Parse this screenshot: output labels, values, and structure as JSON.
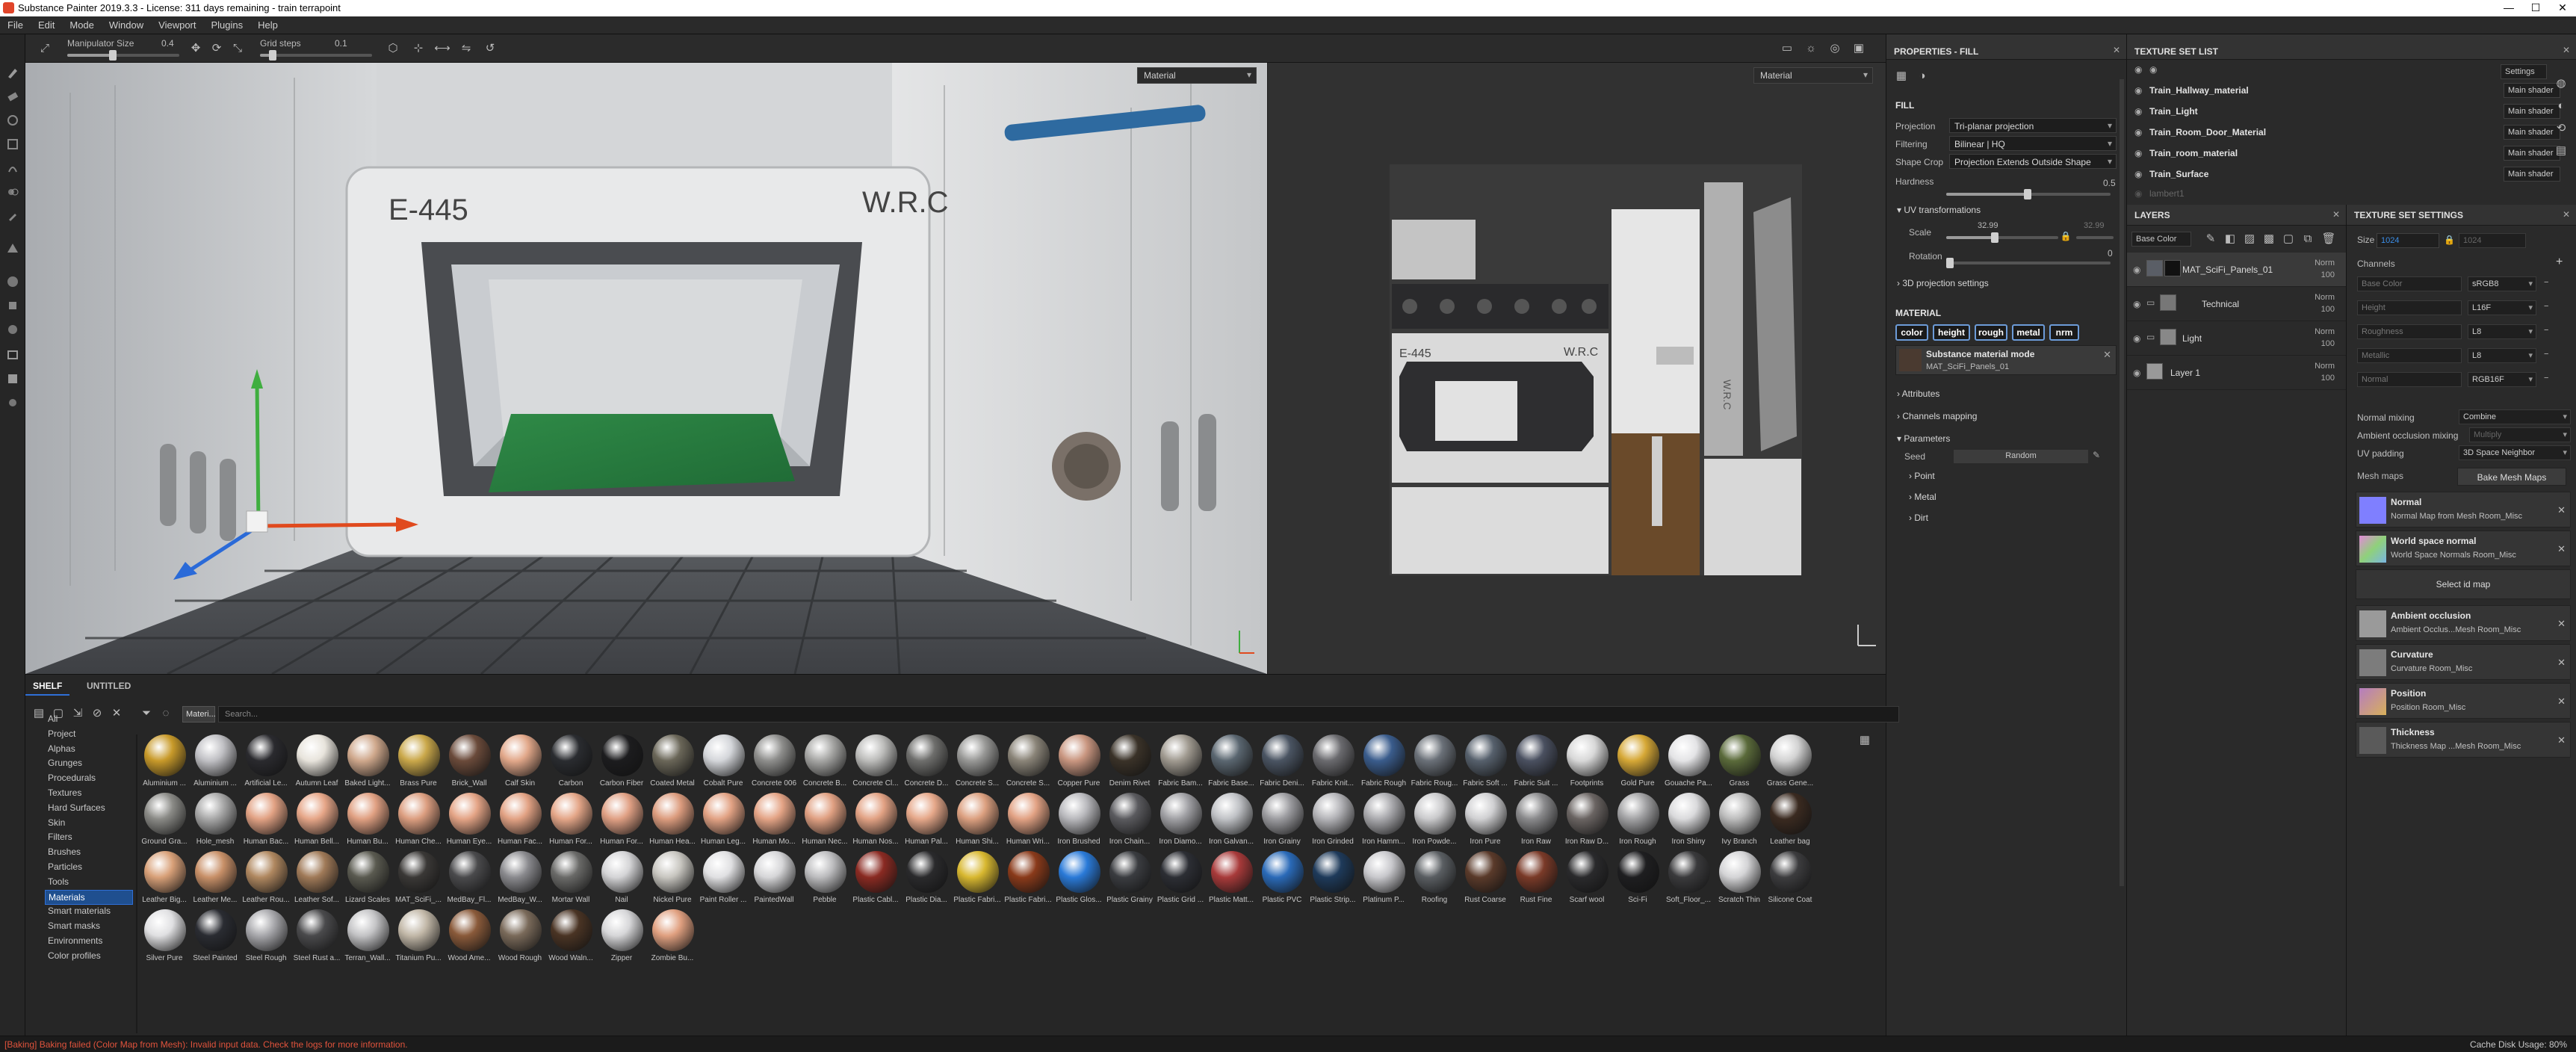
{
  "window": {
    "title": "Substance Painter 2019.3.3 - License: 311 days remaining - train terrapoint",
    "min": "—",
    "max": "☐",
    "close": "✕"
  },
  "menu": [
    "File",
    "Edit",
    "Mode",
    "Window",
    "Viewport",
    "Plugins",
    "Help"
  ],
  "toolbar": {
    "manip_label": "Manipulator Size",
    "manip_value": "0.4",
    "grid_label": "Grid steps",
    "grid_value": "0.1"
  },
  "viewport3d": {
    "mode_select": "Material",
    "texts": {
      "left_sign": "E-445",
      "right_sign": "W.R.C"
    }
  },
  "viewport2d": {
    "mode_select": "Material",
    "texts": {
      "sign_left": "E-445",
      "sign_right": "W.R.C",
      "side": "W.R.C"
    }
  },
  "properties": {
    "title": "PROPERTIES - FILL",
    "fill_header": "FILL",
    "rows": [
      {
        "label": "Projection",
        "value": "Tri-planar projection"
      },
      {
        "label": "Filtering",
        "value": "Bilinear | HQ"
      },
      {
        "label": "Shape Crop",
        "value": "Projection Extends Outside Shape"
      }
    ],
    "hardness_label": "Hardness",
    "hardness_value": "0.5",
    "uv_header": "UV transformations",
    "scale_label": "Scale",
    "scale_a": "32.99",
    "scale_b": "32.99",
    "rotation_label": "Rotation",
    "rotation_value": "0",
    "proj3d": "3D projection settings",
    "material_header": "MATERIAL",
    "chips": [
      "color",
      "height",
      "rough",
      "metal",
      "nrm"
    ],
    "sbs_mode": "Substance material mode",
    "sbs_name": "MAT_SciFi_Panels_01",
    "attributes": "Attributes",
    "channels_mapping": "Channels mapping",
    "parameters": "Parameters",
    "seed_label": "Seed",
    "seed_value": "Random",
    "groups": [
      "Point",
      "Metal",
      "Dirt"
    ]
  },
  "texture_set_list": {
    "title": "TEXTURE SET LIST",
    "settings": "Settings",
    "items": [
      {
        "name": "Train_Hallway_material",
        "shader": "Main shader"
      },
      {
        "name": "Train_Light",
        "shader": "Main shader"
      },
      {
        "name": "Train_Room_Door_Material",
        "shader": "Main shader"
      },
      {
        "name": "Train_room_material",
        "shader": "Main shader"
      },
      {
        "name": "Train_Surface",
        "shader": "Main shader"
      }
    ],
    "disabled_item": "lambert1"
  },
  "layers": {
    "title": "LAYERS",
    "channel": "Base Color",
    "items": [
      {
        "name": "MAT_SciFi_Panels_01",
        "blend": "Norm",
        "opacity": "100"
      },
      {
        "name": "Technical",
        "blend": "Norm",
        "opacity": "100"
      },
      {
        "name": "Light",
        "blend": "Norm",
        "opacity": "100"
      },
      {
        "name": "Layer 1",
        "blend": "Norm",
        "opacity": "100"
      }
    ]
  },
  "texture_set_settings": {
    "title": "TEXTURE SET SETTINGS",
    "size_label": "Size",
    "size_value": "1024",
    "size_linked": "1024",
    "channels_label": "Channels",
    "channels": [
      {
        "name": "Base Color",
        "format": "sRGB8"
      },
      {
        "name": "Height",
        "format": "L16F"
      },
      {
        "name": "Roughness",
        "format": "L8"
      },
      {
        "name": "Metallic",
        "format": "L8"
      },
      {
        "name": "Normal",
        "format": "RGB16F"
      }
    ],
    "normal_mixing_label": "Normal mixing",
    "normal_mixing_value": "Combine",
    "ao_mixing_label": "Ambient occlusion mixing",
    "ao_mixing_value": "Multiply",
    "uv_padding_label": "UV padding",
    "uv_padding_value": "3D Space Neighbor",
    "mesh_maps_label": "Mesh maps",
    "bake_button": "Bake Mesh Maps",
    "select_id": "Select id map",
    "maps": [
      {
        "title": "Normal",
        "sub": "Normal Map from Mesh Room_Misc",
        "color": "#7f7fff"
      },
      {
        "title": "World space normal",
        "sub": "World Space Normals Room_Misc",
        "color": "#8fd17a"
      },
      {
        "title": "Ambient occlusion",
        "sub": "Ambient Occlus...Mesh Room_Misc",
        "color": "#9a9a9a"
      },
      {
        "title": "Curvature",
        "sub": "Curvature Room_Misc",
        "color": "#7c7c7c"
      },
      {
        "title": "Position",
        "sub": "Position Room_Misc",
        "color": "#b57cc0"
      },
      {
        "title": "Thickness",
        "sub": "Thickness Map ...Mesh Room_Misc",
        "color": "#5a5a5a"
      }
    ]
  },
  "shelf": {
    "tab_shelf": "SHELF",
    "tab_untitled": "UNTITLED",
    "filter_chip": "Materi...",
    "search_placeholder": "Search...",
    "categories": [
      "All",
      "Project",
      "Alphas",
      "Grunges",
      "Procedurals",
      "Textures",
      "Hard Surfaces",
      "Skin",
      "Filters",
      "Brushes",
      "Particles",
      "Tools",
      "Materials",
      "Smart materials",
      "Smart masks",
      "Environments",
      "Color profiles"
    ],
    "selected_category": "Materials",
    "materials": [
      {
        "name": "Aluminium ...",
        "color": "#c89a2a"
      },
      {
        "name": "Aluminium ...",
        "color": "#c0c0c4"
      },
      {
        "name": "Artificial Le...",
        "color": "#2a2a2e"
      },
      {
        "name": "Autumn Leaf",
        "color": "#e8e4dc"
      },
      {
        "name": "Baked Light...",
        "color": "#cfa88c"
      },
      {
        "name": "Brass Pure",
        "color": "#caa84a"
      },
      {
        "name": "Brick_Wall",
        "color": "#6a4a3a"
      },
      {
        "name": "Calf Skin",
        "color": "#e2a88a"
      },
      {
        "name": "Carbon",
        "color": "#2a2c30"
      },
      {
        "name": "Carbon Fiber",
        "color": "#1c1c1e"
      },
      {
        "name": "Coated Metal",
        "color": "#6a6658"
      },
      {
        "name": "Cobalt Pure",
        "color": "#d4d6da"
      },
      {
        "name": "Concrete 006",
        "color": "#8e8e8c"
      },
      {
        "name": "Concrete B...",
        "color": "#a6a6a4"
      },
      {
        "name": "Concrete Cl...",
        "color": "#bcbcba"
      },
      {
        "name": "Concrete D...",
        "color": "#6e6e6c"
      },
      {
        "name": "Concrete S...",
        "color": "#989896"
      },
      {
        "name": "Concrete S...",
        "color": "#8a8478"
      },
      {
        "name": "Copper Pure",
        "color": "#c99680"
      },
      {
        "name": "Denim Rivet",
        "color": "#3a3228"
      },
      {
        "name": "Fabric Bam...",
        "color": "#a09a90"
      },
      {
        "name": "Fabric Base...",
        "color": "#5a6670"
      },
      {
        "name": "Fabric Deni...",
        "color": "#4a5462"
      },
      {
        "name": "Fabric Knit...",
        "color": "#6a6a6e"
      },
      {
        "name": "Fabric Rough",
        "color": "#3a5c8c"
      },
      {
        "name": "Fabric Roug...",
        "color": "#6a7078"
      },
      {
        "name": "Fabric Soft ...",
        "color": "#56606c"
      },
      {
        "name": "Fabric Suit ...",
        "color": "#4a5060"
      },
      {
        "name": "Footprints",
        "color": "#d8d8d8"
      },
      {
        "name": "Gold Pure",
        "color": "#d6a836"
      },
      {
        "name": "Gouache Pa...",
        "color": "#e4e4e6"
      },
      {
        "name": "Grass",
        "color": "#5a6a3a"
      },
      {
        "name": "Grass Gene...",
        "color": "#d2d2d2"
      },
      {
        "name": "Ground Gra...",
        "color": "#8a8a86"
      },
      {
        "name": "Hole_mesh",
        "color": "#a8a8a8"
      },
      {
        "name": "Human Bac...",
        "color": "#e2a284"
      },
      {
        "name": "Human Bell...",
        "color": "#e6a688"
      },
      {
        "name": "Human Bu...",
        "color": "#e0a082"
      },
      {
        "name": "Human Che...",
        "color": "#dc9e80"
      },
      {
        "name": "Human Eye...",
        "color": "#e4a486"
      },
      {
        "name": "Human Fac...",
        "color": "#e2a284"
      },
      {
        "name": "Human For...",
        "color": "#e4a688"
      },
      {
        "name": "Human For...",
        "color": "#e0a084"
      },
      {
        "name": "Human Hea...",
        "color": "#dc9c7e"
      },
      {
        "name": "Human Leg...",
        "color": "#e2a284"
      },
      {
        "name": "Human Mo...",
        "color": "#e4a486"
      },
      {
        "name": "Human Nec...",
        "color": "#e0a082"
      },
      {
        "name": "Human Nos...",
        "color": "#e2a284"
      },
      {
        "name": "Human Pal...",
        "color": "#e6a88a"
      },
      {
        "name": "Human Shi...",
        "color": "#dca080"
      },
      {
        "name": "Human Wri...",
        "color": "#e2a284"
      },
      {
        "name": "Iron Brushed",
        "color": "#b8b8bc"
      },
      {
        "name": "Iron Chain...",
        "color": "#5a5a5e"
      },
      {
        "name": "Iron Diamo...",
        "color": "#a0a0a4"
      },
      {
        "name": "Iron Galvan...",
        "color": "#c0c2c6"
      },
      {
        "name": "Iron Grainy",
        "color": "#9c9ca0"
      },
      {
        "name": "Iron Grinded",
        "color": "#b4b4b8"
      },
      {
        "name": "Iron Hamm...",
        "color": "#aaaaae"
      },
      {
        "name": "Iron Powde...",
        "color": "#cacacc"
      },
      {
        "name": "Iron Pure",
        "color": "#d0d0d2"
      },
      {
        "name": "Iron Raw",
        "color": "#8a8a8c"
      },
      {
        "name": "Iron Raw D...",
        "color": "#6a6462"
      },
      {
        "name": "Iron Rough",
        "color": "#a2a2a4"
      },
      {
        "name": "Iron Shiny",
        "color": "#dadadc"
      },
      {
        "name": "Ivy Branch",
        "color": "#bcbcbc"
      },
      {
        "name": "Leather bag",
        "color": "#3a2a20"
      },
      {
        "name": "Leather Big...",
        "color": "#d8a078"
      },
      {
        "name": "Leather Me...",
        "color": "#c89068"
      },
      {
        "name": "Leather Rou...",
        "color": "#b08860"
      },
      {
        "name": "Leather Sof...",
        "color": "#a07a58"
      },
      {
        "name": "Lizard Scales",
        "color": "#5a5a50"
      },
      {
        "name": "MAT_SciFi_...",
        "color": "#3a3836"
      },
      {
        "name": "MedBay_Fl...",
        "color": "#4a4a4c"
      },
      {
        "name": "MedBay_W...",
        "color": "#8a8a8e"
      },
      {
        "name": "Mortar Wall",
        "color": "#6a6a68"
      },
      {
        "name": "Nail",
        "color": "#d4d4d6"
      },
      {
        "name": "Nickel Pure",
        "color": "#c8c6c0"
      },
      {
        "name": "Paint Roller ...",
        "color": "#e0e0e2"
      },
      {
        "name": "PaintedWall",
        "color": "#d6d6d8"
      },
      {
        "name": "Pebble",
        "color": "#bcbcbe"
      },
      {
        "name": "Plastic Cabl...",
        "color": "#8a2a22"
      },
      {
        "name": "Plastic Dia...",
        "color": "#2a2a2c"
      },
      {
        "name": "Plastic Fabri...",
        "color": "#d8b830"
      },
      {
        "name": "Plastic Fabri...",
        "color": "#8a3a1a"
      },
      {
        "name": "Plastic Glos...",
        "color": "#2a7ad8"
      },
      {
        "name": "Plastic Grainy",
        "color": "#3a3c40"
      },
      {
        "name": "Plastic Grid ...",
        "color": "#2c2e34"
      },
      {
        "name": "Plastic Matt...",
        "color": "#a83a3a"
      },
      {
        "name": "Plastic PVC",
        "color": "#2a6ab8"
      },
      {
        "name": "Plastic Strip...",
        "color": "#1e3a5a"
      },
      {
        "name": "Platinum P...",
        "color": "#c8c8cc"
      },
      {
        "name": "Roofing",
        "color": "#5a5e62"
      },
      {
        "name": "Rust Coarse",
        "color": "#5a3a2a"
      },
      {
        "name": "Rust Fine",
        "color": "#7a3a28"
      },
      {
        "name": "Scarf wool",
        "color": "#2a2a2c"
      },
      {
        "name": "Sci-Fi",
        "color": "#1e1e20"
      },
      {
        "name": "Soft_Floor_...",
        "color": "#3a3a3c"
      },
      {
        "name": "Scratch Thin",
        "color": "#d4d4d6"
      },
      {
        "name": "Silicone Coat",
        "color": "#3c3c3e"
      },
      {
        "name": "Silver Pure",
        "color": "#e0e0e2"
      },
      {
        "name": "Steel Painted",
        "color": "#2a2c32"
      },
      {
        "name": "Steel Rough",
        "color": "#a8a8ac"
      },
      {
        "name": "Steel Rust a...",
        "color": "#4a4a4c"
      },
      {
        "name": "Terran_Wall...",
        "color": "#c4c4c6"
      },
      {
        "name": "Titanium Pu...",
        "color": "#c2b8a8"
      },
      {
        "name": "Wood Ame...",
        "color": "#8a5a3a"
      },
      {
        "name": "Wood Rough",
        "color": "#7a6a5a"
      },
      {
        "name": "Wood Waln...",
        "color": "#4a3424"
      },
      {
        "name": "Zipper",
        "color": "#d6d6d8"
      },
      {
        "name": "Zombie Bu...",
        "color": "#e0a080"
      }
    ]
  },
  "status": {
    "error": "[Baking] Baking failed (Color Map from Mesh): Invalid input data. Check the logs for more information.",
    "cache": "Cache Disk Usage:   80%"
  },
  "colors": {
    "accent": "#2f6fd6",
    "error": "#e0533c",
    "selection": "#1f4f8f"
  }
}
